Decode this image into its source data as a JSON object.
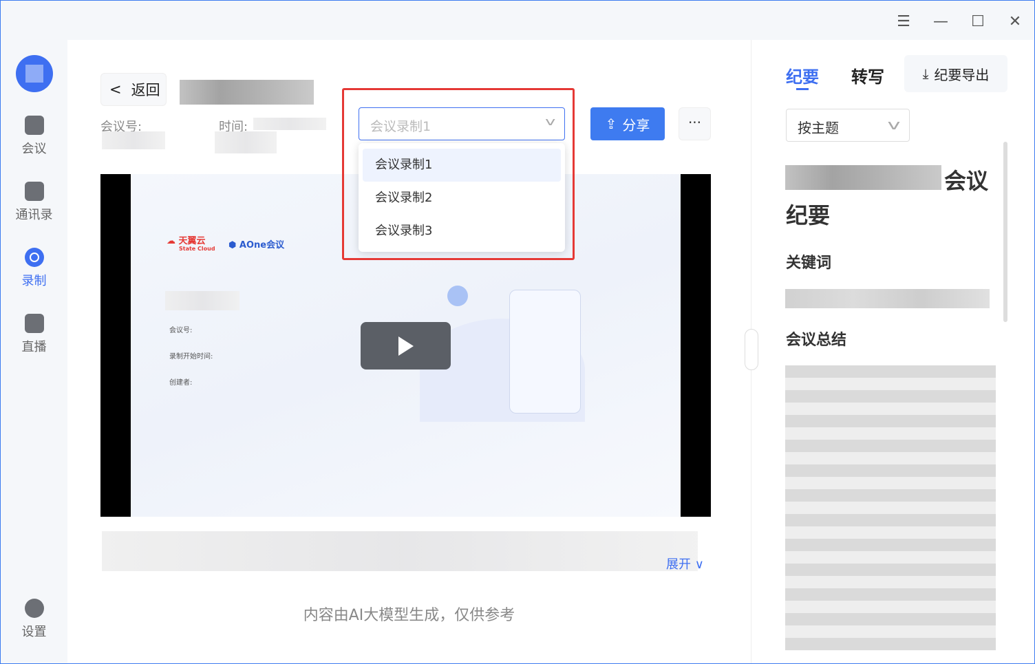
{
  "window": {
    "controls": [
      "menu-icon",
      "minimize-icon",
      "maximize-icon",
      "close-icon"
    ]
  },
  "sidebar": {
    "items": [
      {
        "label": "会议",
        "icon": "meeting-icon"
      },
      {
        "label": "通讯录",
        "icon": "contacts-icon"
      },
      {
        "label": "录制",
        "icon": "record-icon",
        "active": true
      },
      {
        "label": "直播",
        "icon": "live-icon"
      },
      {
        "label": "设置",
        "icon": "gear-icon"
      }
    ]
  },
  "header": {
    "back_label": "返回",
    "meeting_no_label": "会议号:",
    "time_label": "时间:"
  },
  "recording_select": {
    "value": "会议录制1",
    "options": [
      "会议录制1",
      "会议录制2",
      "会议录制3"
    ]
  },
  "share_label": "分享",
  "more_label": "···",
  "video": {
    "brand1": "天翼云",
    "brand1_sub": "State Cloud",
    "brand2": "AOne会议",
    "meeting_no_label": "会议号:",
    "start_time_label": "录制开始时间:",
    "creator_label": "创建者:"
  },
  "expand_label": "展开",
  "disclaimer": "内容由AI大模型生成，仅供参考",
  "right": {
    "tabs": [
      "纪要",
      "转写"
    ],
    "export_label": "纪要导出",
    "topic_select": "按主题",
    "title_suffix": "会议",
    "title_line2": "纪要",
    "keywords_heading": "关键词",
    "summary_heading": "会议总结"
  },
  "colors": {
    "accent": "#3e6ff1",
    "highlight": "#e53935"
  }
}
